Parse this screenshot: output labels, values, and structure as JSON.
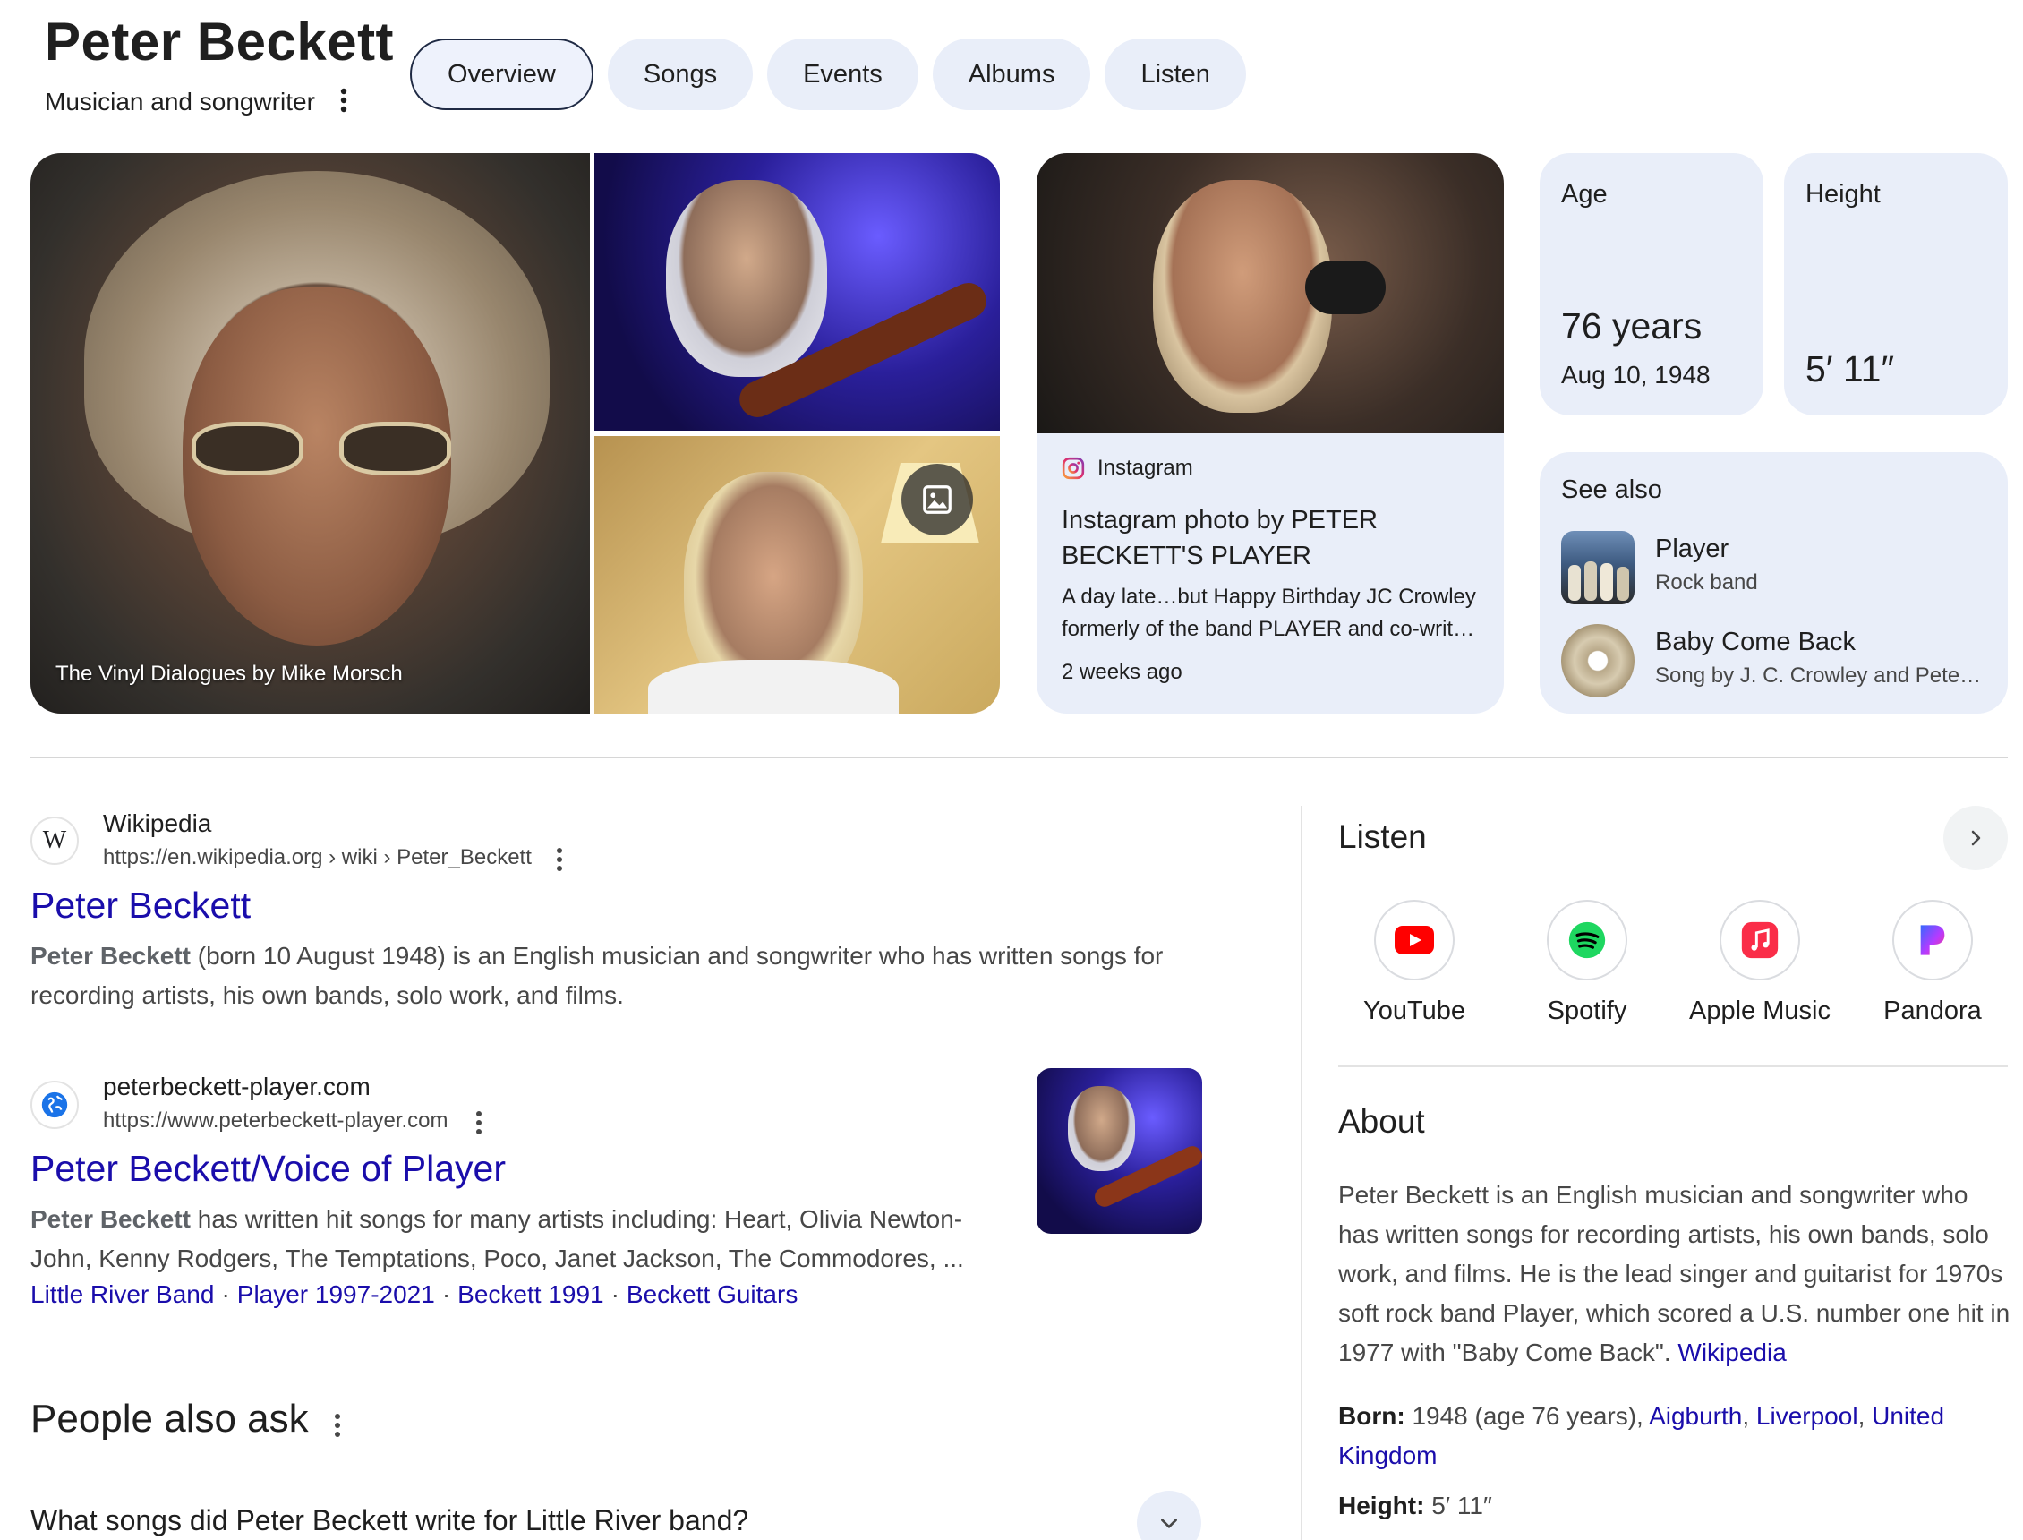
{
  "header": {
    "title": "Peter Beckett",
    "subtitle": "Musician and songwriter",
    "tabs": [
      {
        "label": "Overview",
        "active": true
      },
      {
        "label": "Songs"
      },
      {
        "label": "Events"
      },
      {
        "label": "Albums"
      },
      {
        "label": "Listen"
      }
    ]
  },
  "gallery": {
    "main_caption": "The Vinyl Dialogues by Mike Morsch"
  },
  "instagram_card": {
    "source": "Instagram",
    "title": "Instagram photo by PETER BECKETT'S PLAYER",
    "description_line1": "A day late…but Happy Birthday JC Crowley",
    "description_line2": "formerly of the band PLAYER and co-writ…",
    "time": "2 weeks ago"
  },
  "stats": {
    "age": {
      "label": "Age",
      "value": "76 years",
      "sub": "Aug 10, 1948"
    },
    "height": {
      "label": "Height",
      "value": "5′ 11″"
    }
  },
  "see_also": {
    "title": "See also",
    "items": [
      {
        "name": "Player",
        "desc": "Rock band"
      },
      {
        "name": "Baby Come Back",
        "desc": "Song by J. C. Crowley and Pete…"
      }
    ]
  },
  "results": [
    {
      "site_name": "Wikipedia",
      "favicon_letter": "W",
      "url": "https://en.wikipedia.org › wiki › Peter_Beckett",
      "title": "Peter Beckett",
      "snippet_bold": "Peter Beckett",
      "snippet_line1": " (born 10 August 1948) is an English musician and songwriter who has written songs for",
      "snippet_line2": "recording artists, his own bands, solo work, and films."
    },
    {
      "site_name": "peterbeckett-player.com",
      "url": "https://www.peterbeckett-player.com",
      "title": "Peter Beckett/Voice of Player",
      "snippet_bold": "Peter Beckett",
      "snippet_line1": " has written hit songs for many artists including: Heart, Olivia Newton-",
      "snippet_line2": "John, Kenny Rodgers, The Temptations, Poco, Janet Jackson, The Commodores, ...",
      "sitelinks": [
        "Little River Band",
        "Player 1997-2021",
        "Beckett 1991",
        "Beckett Guitars"
      ],
      "sitelink_separator": "·"
    }
  ],
  "people_also_ask": {
    "title": "People also ask",
    "questions": [
      "What songs did Peter Beckett write for Little River band?"
    ]
  },
  "listen": {
    "title": "Listen",
    "services": [
      {
        "label": "YouTube",
        "color": "#ff0000"
      },
      {
        "label": "Spotify",
        "color": "#1ed760"
      },
      {
        "label": "Apple Music",
        "color": "#fa2d48"
      },
      {
        "label": "Pandora",
        "color": "#3668ff"
      }
    ]
  },
  "about": {
    "title": "About",
    "text": "Peter Beckett is an English musician and songwriter who has written songs for recording artists, his own bands, solo work, and films. He is the lead singer and guitarist for 1970s soft rock band Player, which scored a U.S. number one hit in 1977 with \"Baby Come Back\".",
    "source_link": "Wikipedia",
    "born_label": "Born:",
    "born_value": "1948 (age 76 years),",
    "born_links": [
      "Aigburth",
      "Liverpool",
      "United Kingdom"
    ],
    "born_sep": ",",
    "height_label": "Height:",
    "height_value": "5′ 11″"
  },
  "colors": {
    "link": "#1a0dab",
    "chip_bg": "#e9eef9",
    "text": "#1f1f1f",
    "muted": "#474747"
  }
}
